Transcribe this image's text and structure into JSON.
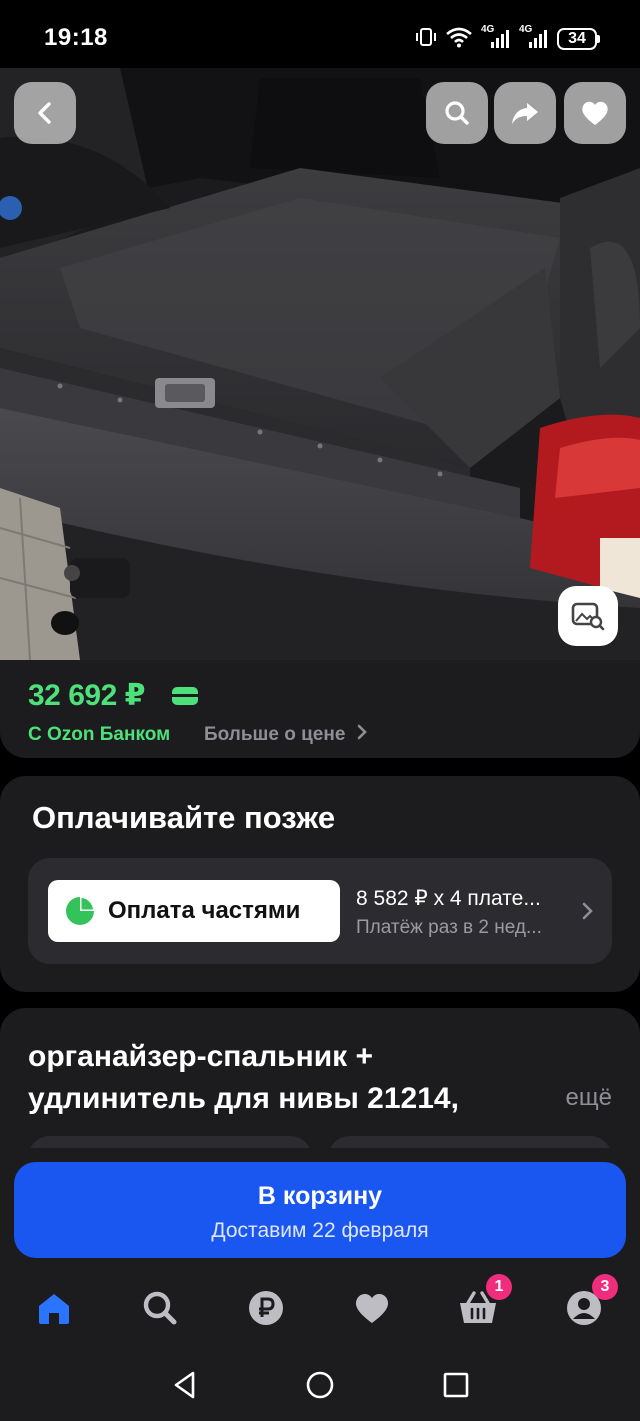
{
  "status_bar": {
    "time": "19:18",
    "network_1": "4G",
    "network_2": "4G",
    "battery": "34"
  },
  "product": {
    "image_description": "car-trunk-organizer-photo",
    "price": "32 692 ₽",
    "bank_label": "С Ozon Банком",
    "more_price_label": "Больше о цене",
    "title": "органайзер-спальник + удлинитель для нивы 21214,",
    "more_label": "ещё"
  },
  "pay_later": {
    "title": "Оплачивайте позже",
    "split_label": "Оплата частями",
    "plan_amount": "8 582 ₽ x 4 плате...",
    "plan_sub": "Платёж раз в 2 нед..."
  },
  "cart": {
    "label": "В корзину",
    "delivery": "Доставим 22 февраля"
  },
  "tabs": {
    "cart_badge": "1",
    "profile_badge": "3"
  },
  "colors": {
    "accent_green": "#4ee07a",
    "primary_blue": "#1a56f0",
    "badge_pink": "#ef2d7c"
  }
}
